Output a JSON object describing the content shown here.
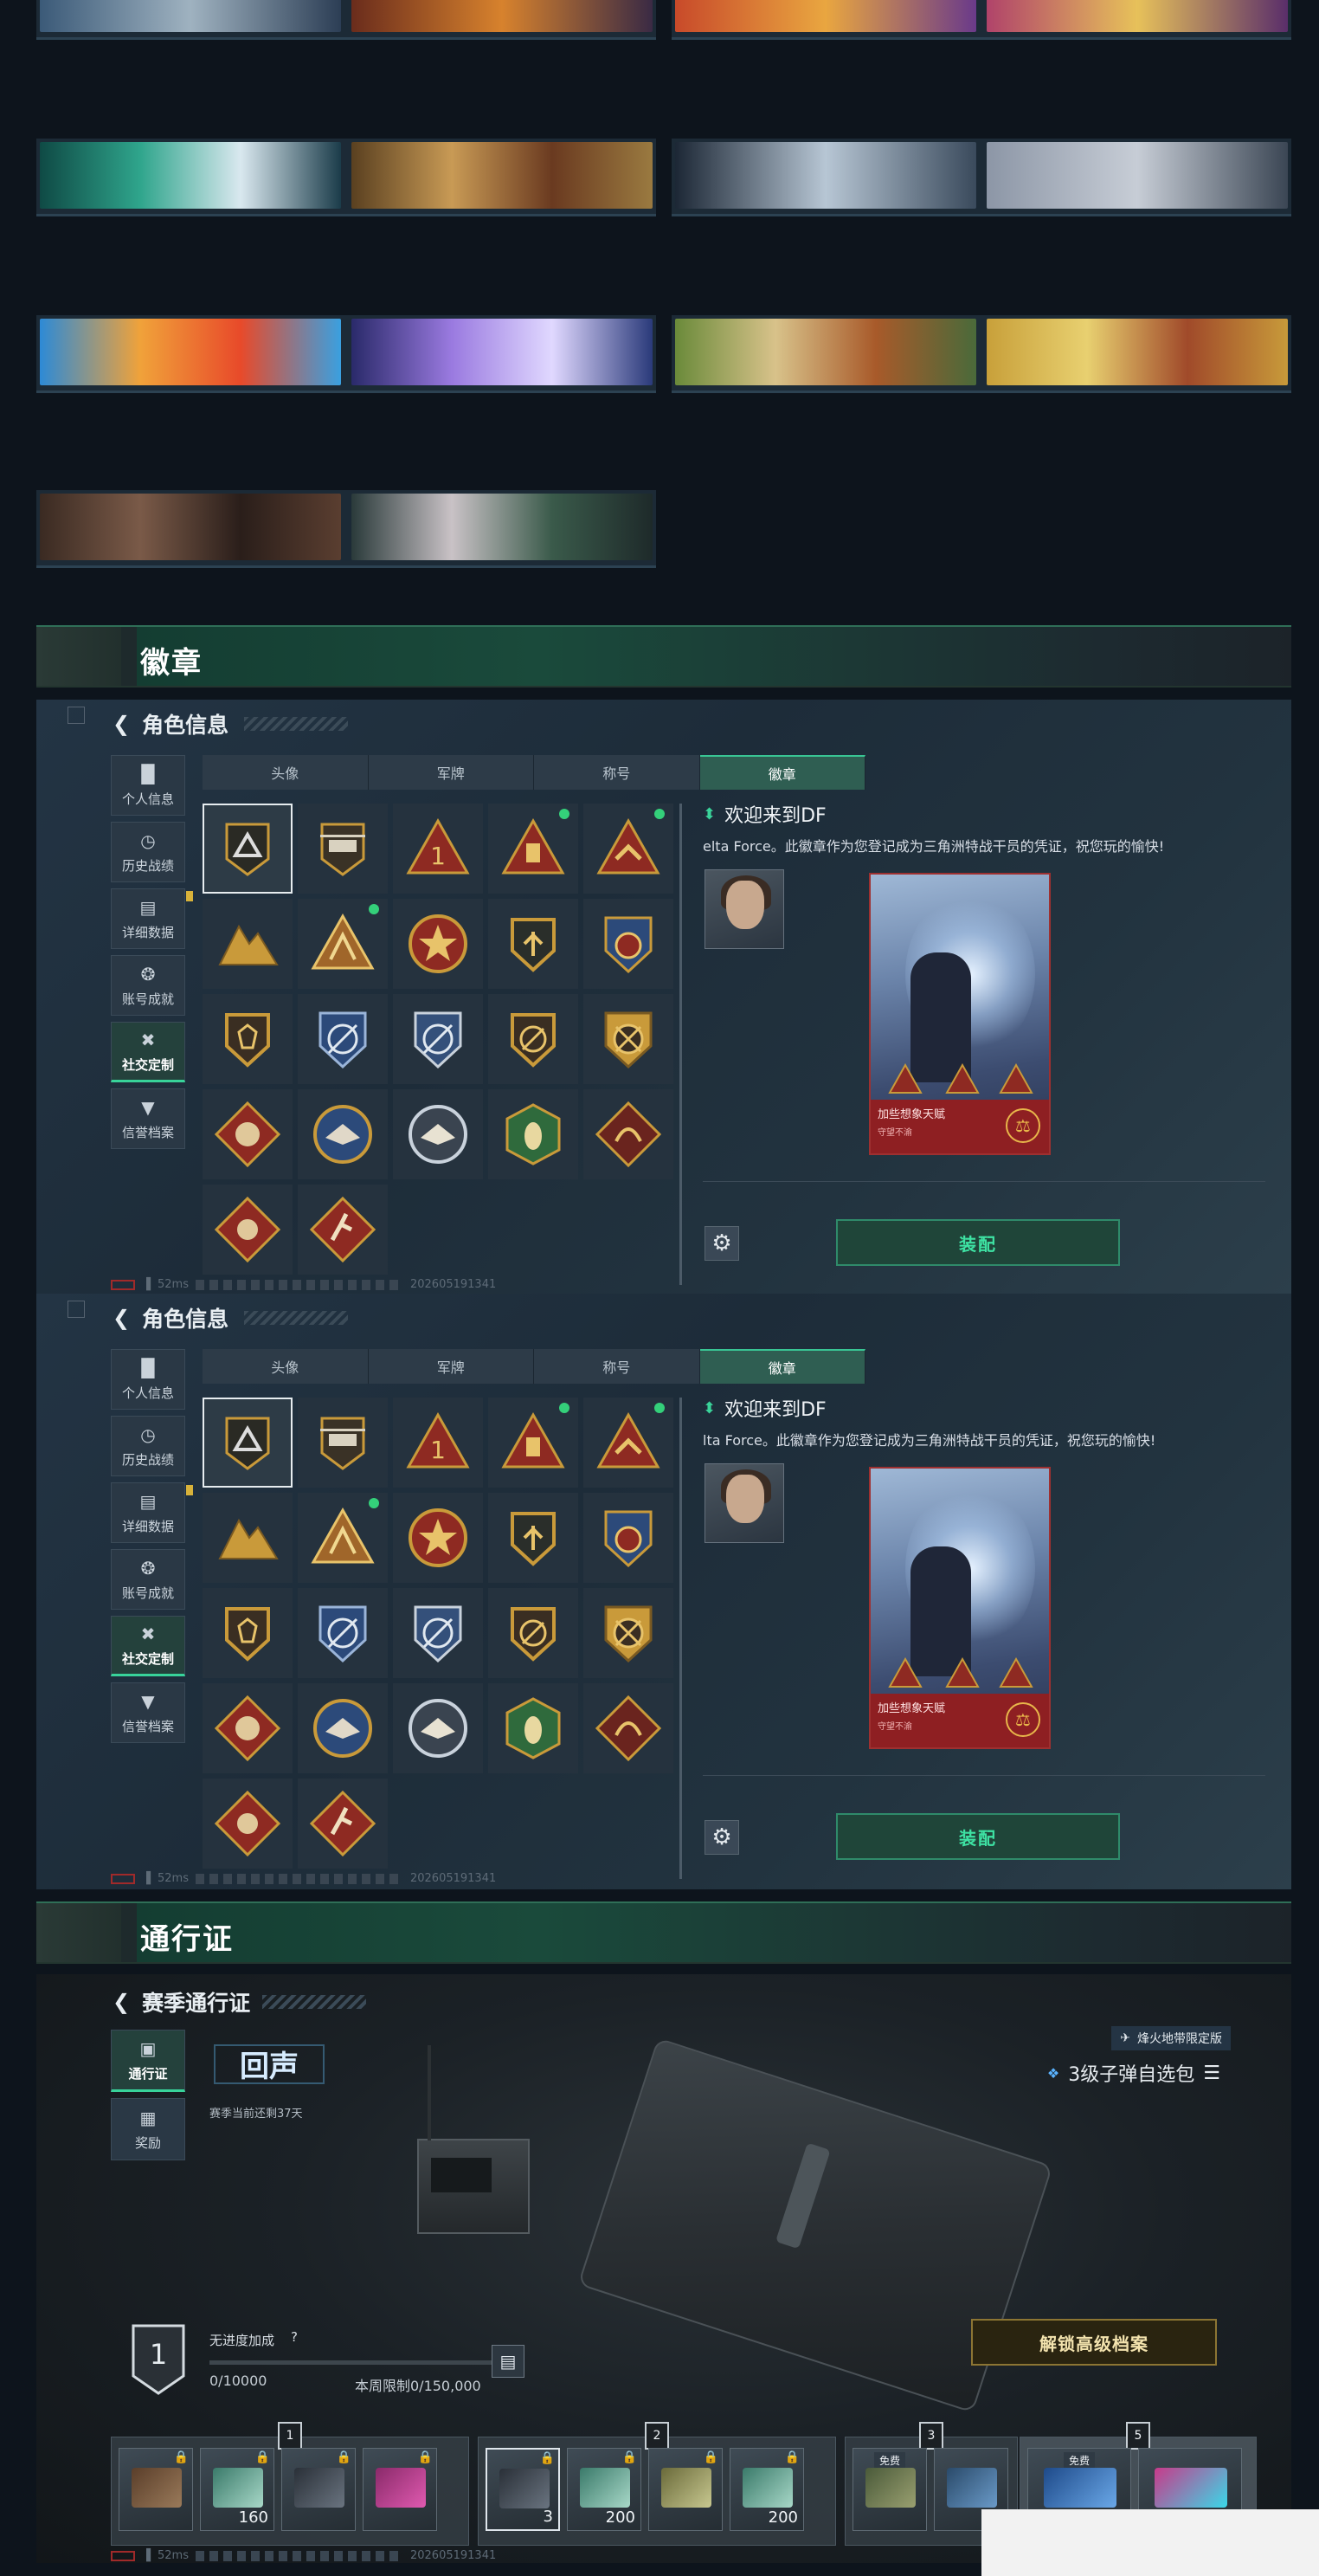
{
  "sections": {
    "badges_title": "徽章",
    "pass_title": "通行证"
  },
  "panel": {
    "title": "角色信息",
    "side_nav": [
      {
        "label": "个人信息",
        "icon": "bar-chart-icon"
      },
      {
        "label": "历史战绩",
        "icon": "clock-icon"
      },
      {
        "label": "详细数据",
        "icon": "folder-icon"
      },
      {
        "label": "账号成就",
        "icon": "medal-icon"
      },
      {
        "label": "社交定制",
        "icon": "tools-icon"
      },
      {
        "label": "信誉档案",
        "icon": "shield-check-icon"
      }
    ],
    "tabs": [
      "头像",
      "军牌",
      "称号",
      "徽章"
    ],
    "active_tab": "徽章",
    "selected_badge": {
      "title": "欢迎来到DF",
      "description": "elta Force。此徽章作为您登记成为三角洲特战干员的凭证，祝您玩的愉快!"
    },
    "card": {
      "footer_title": "加些想象天赋",
      "footer_sub": "守望不渝"
    },
    "equip_label": "装配",
    "status": {
      "ping": "52ms",
      "id": "202605191341"
    }
  },
  "panel2_desc": "lta Force。此徽章作为您登记成为三角洲特战干员的凭证，祝您玩的愉快!",
  "badge_colors": {
    "gold": "#c99a3a",
    "red": "#8e2a22",
    "blue": "#2c4a7a",
    "green": "#2f6a3c"
  },
  "pass": {
    "title": "赛季通行证",
    "side_nav": [
      {
        "label": "通行证",
        "icon": "pass-icon"
      },
      {
        "label": "奖励",
        "icon": "gift-icon"
      }
    ],
    "logo": "回声",
    "season_left": "赛季当前还剩37天",
    "limited_tag": "烽火地带限定版",
    "pack_line": "3级子弹自选包",
    "rank": "1",
    "boost_text": "无进度加成",
    "boost_help": "?",
    "xp_progress": "0/10000",
    "xp_fill": 0,
    "week_limit": "本周限制0/150,000",
    "unlock_label": "解锁高级档案",
    "tiers": [
      {
        "label": "1",
        "rewards": [
          {
            "qty": ""
          },
          {
            "qty": "160"
          },
          {
            "qty": ""
          },
          {
            "qty": ""
          }
        ]
      },
      {
        "label": "2",
        "rewards": [
          {
            "qty": "3"
          },
          {
            "qty": "200"
          },
          {
            "qty": ""
          },
          {
            "qty": "200"
          }
        ]
      },
      {
        "label": "3",
        "rewards": [
          {
            "qty": "",
            "free": "免费"
          },
          {
            "qty": ""
          }
        ]
      },
      {
        "label": "5",
        "rewards": [
          {
            "qty": "",
            "free": "免费"
          },
          {
            "qty": ""
          }
        ]
      }
    ],
    "status": {
      "ping": "52ms",
      "id": "202605191341"
    }
  }
}
